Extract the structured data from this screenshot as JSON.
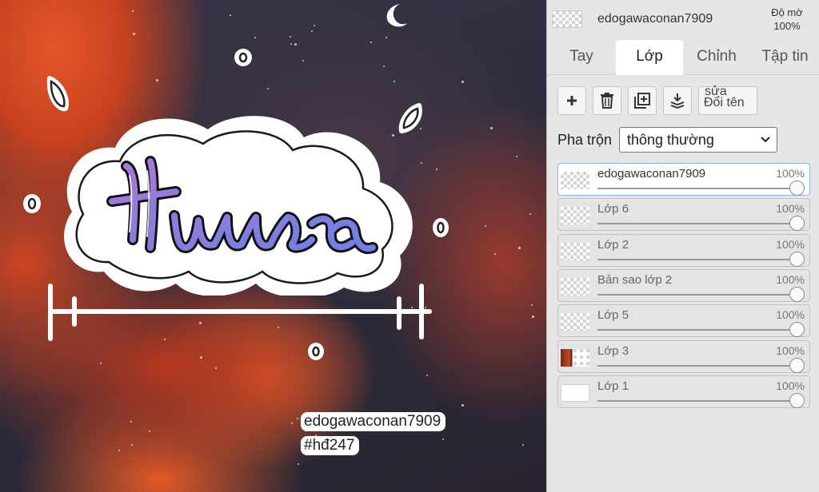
{
  "canvas": {
    "tag_username": "edogawaconan7909",
    "tag_hashtag": "#hđ247"
  },
  "panel": {
    "header": {
      "layer_name": "edogawaconan7909",
      "opacity_label": "Độ mờ",
      "opacity_value": "100%"
    },
    "tabs": [
      {
        "label": "Tay",
        "active": false
      },
      {
        "label": "Lớp",
        "active": true
      },
      {
        "label": "Chỉnh",
        "active": false
      },
      {
        "label": "Tập tin",
        "active": false
      }
    ],
    "toolbar": {
      "add_icon": "plus-icon",
      "delete_icon": "trash-icon",
      "duplicate_icon": "duplicate-icon",
      "merge_down_icon": "merge-down-icon",
      "rename_label": "Đổi tên",
      "rename_overlay": "sửa"
    },
    "blend": {
      "label": "Pha trộn",
      "selected": "thông thường"
    },
    "layers": [
      {
        "name": "edogawaconan7909",
        "opacity": "100%",
        "opacity_level": 1.0,
        "active": true,
        "thumb": "checker"
      },
      {
        "name": "Lớp 6",
        "opacity": "100%",
        "opacity_level": 1.0,
        "active": false,
        "thumb": "checker"
      },
      {
        "name": "Lớp 2",
        "opacity": "100%",
        "opacity_level": 1.0,
        "active": false,
        "thumb": "checker"
      },
      {
        "name": "Bản sao lớp 2",
        "opacity": "100%",
        "opacity_level": 1.0,
        "active": false,
        "thumb": "checker"
      },
      {
        "name": "Lớp 5",
        "opacity": "100%",
        "opacity_level": 1.0,
        "active": false,
        "thumb": "checker"
      },
      {
        "name": "Lớp 3",
        "opacity": "100%",
        "opacity_level": 1.0,
        "active": false,
        "thumb": "image"
      },
      {
        "name": "Lớp 1",
        "opacity": "100%",
        "opacity_level": 1.0,
        "active": false,
        "thumb": "white"
      }
    ],
    "colors": {
      "active_border": "#8fb2df",
      "panel_bg": "#e6e6e6"
    }
  }
}
